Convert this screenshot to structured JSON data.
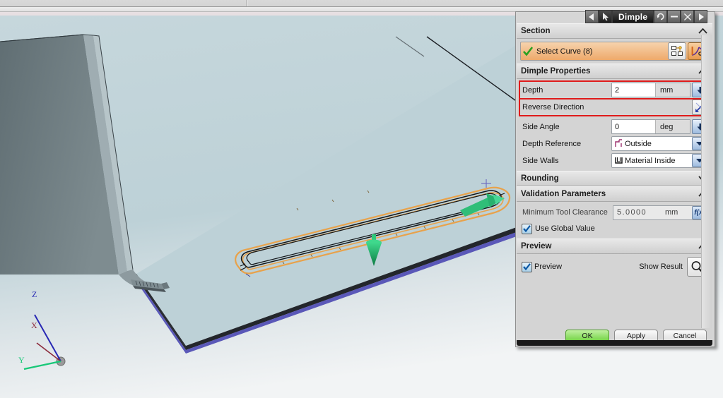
{
  "window": {
    "title": "Dimple",
    "titlebar_buttons": [
      {
        "name": "nav-back",
        "glyph": "<"
      },
      {
        "name": "pointer",
        "glyph": "arrow"
      },
      {
        "name": "reset",
        "glyph": "reset"
      },
      {
        "name": "minimize",
        "glyph": "-"
      },
      {
        "name": "close",
        "glyph": "x"
      },
      {
        "name": "nav-forward",
        "glyph": ">"
      }
    ]
  },
  "sections": {
    "section": {
      "header": "Section",
      "collapsed": false,
      "select_curve_label": "Select Curve (8)",
      "buttons": [
        "section-builder-icon",
        "curve-rule-icon"
      ]
    },
    "dimple_properties": {
      "header": "Dimple Properties",
      "collapsed": false,
      "depth": {
        "label": "Depth",
        "value": "2",
        "unit": "mm",
        "highlighted": true
      },
      "reverse_direction": {
        "label": "Reverse Direction",
        "highlighted": true
      },
      "side_angle": {
        "label": "Side Angle",
        "value": "0",
        "unit": "deg"
      },
      "depth_reference": {
        "label": "Depth Reference",
        "value": "Outside"
      },
      "side_walls": {
        "label": "Side Walls",
        "value": "Material Inside"
      }
    },
    "rounding": {
      "header": "Rounding",
      "collapsed": true
    },
    "validation_parameters": {
      "header": "Validation Parameters",
      "collapsed": false,
      "minimum_tool_clearance": {
        "label": "Minimum Tool Clearance",
        "value": "5.0000",
        "unit": "mm",
        "formula_icon": "f(x)"
      },
      "use_global_value": {
        "label": "Use Global Value",
        "checked": true
      }
    },
    "preview": {
      "header": "Preview",
      "collapsed": false,
      "preview_checkbox": {
        "label": "Preview",
        "checked": true
      },
      "show_result_label": "Show Result"
    }
  },
  "footer": {
    "ok": "OK",
    "apply": "Apply",
    "cancel": "Cancel"
  },
  "viewport": {
    "triad": {
      "z_label": "Z",
      "x_label": "X",
      "y_label": "Y",
      "z_color": "#2828b4",
      "x_color": "#8c2b3c",
      "y_color": "#18c878"
    },
    "colors": {
      "background_top": "#c3d5da",
      "background_bottom": "#e9eef0",
      "sheet_face": "#bcd1d6",
      "flange_face": "#5d6b70",
      "selected_curve": "#e8a24b",
      "direction_arrow": "#1aa35c",
      "edge_highlight": "#5a58b8"
    }
  }
}
